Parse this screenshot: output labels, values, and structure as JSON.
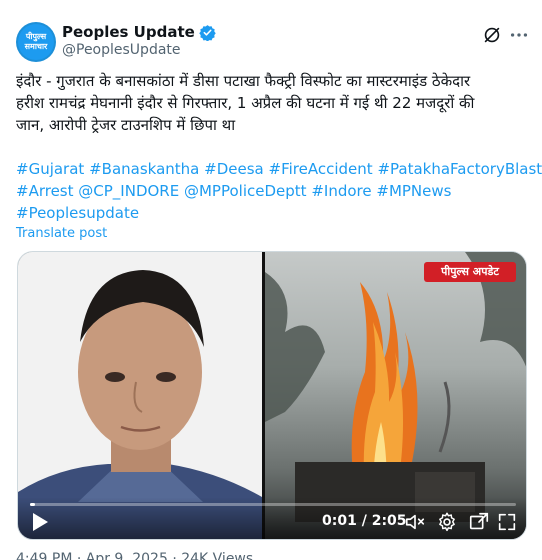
{
  "author": {
    "display_name": "Peoples Update",
    "handle": "@PeoplesUpdate",
    "avatar_text_line1": "पीपुल्स",
    "avatar_text_line2": "समाचार"
  },
  "post": {
    "text_lines": [
      "इंदौर - गुजरात के बनासकांठा में डीसा पटाखा फैक्ट्री विस्फोट का मास्टरमाइंड ठेकेदार",
      "हरीश रामचंद्र मेघनानी इंदौर से गिरफ्तार, 1 अप्रैल की घटना में गई थी 22 मजदूरों की",
      "जान, आरोपी ट्रेजर टाउनशिप में छिपा था"
    ],
    "hashtags": {
      "gujarat": "#Gujarat",
      "banaskantha": "#Banaskantha",
      "deesa": "#Deesa",
      "fireaccident": "#FireAccident",
      "patakha": "#PatakhaFactoryBlast",
      "arrest": "#Arrest",
      "cp_indore": "@CP_INDORE",
      "mppolice": "@MPPoliceDeptt",
      "indore": "#Indore",
      "mpnews": "#MPNews",
      "peoplesupdate": "#Peoplesupdate"
    },
    "translate_label": "Translate post"
  },
  "media": {
    "brand_badge": "पीपुल्स अपडेट",
    "current_time": "0:01",
    "duration": "2:05",
    "progress_fraction": 0.008
  },
  "footer": {
    "partial_text": "4:49 PM · Apr 9, 2025 · 24K Views"
  },
  "icons": {
    "verified": "verified-badge-icon",
    "grok": "grok-icon",
    "more": "more-icon",
    "play": "play-icon",
    "mute": "muted-speaker-icon",
    "settings": "gear-icon",
    "fullscreen": "fullscreen-icon"
  },
  "colors": {
    "accent": "#1d9bf0",
    "text": "#0f1419",
    "secondary": "#536471",
    "badge_red": "#d21f26"
  }
}
